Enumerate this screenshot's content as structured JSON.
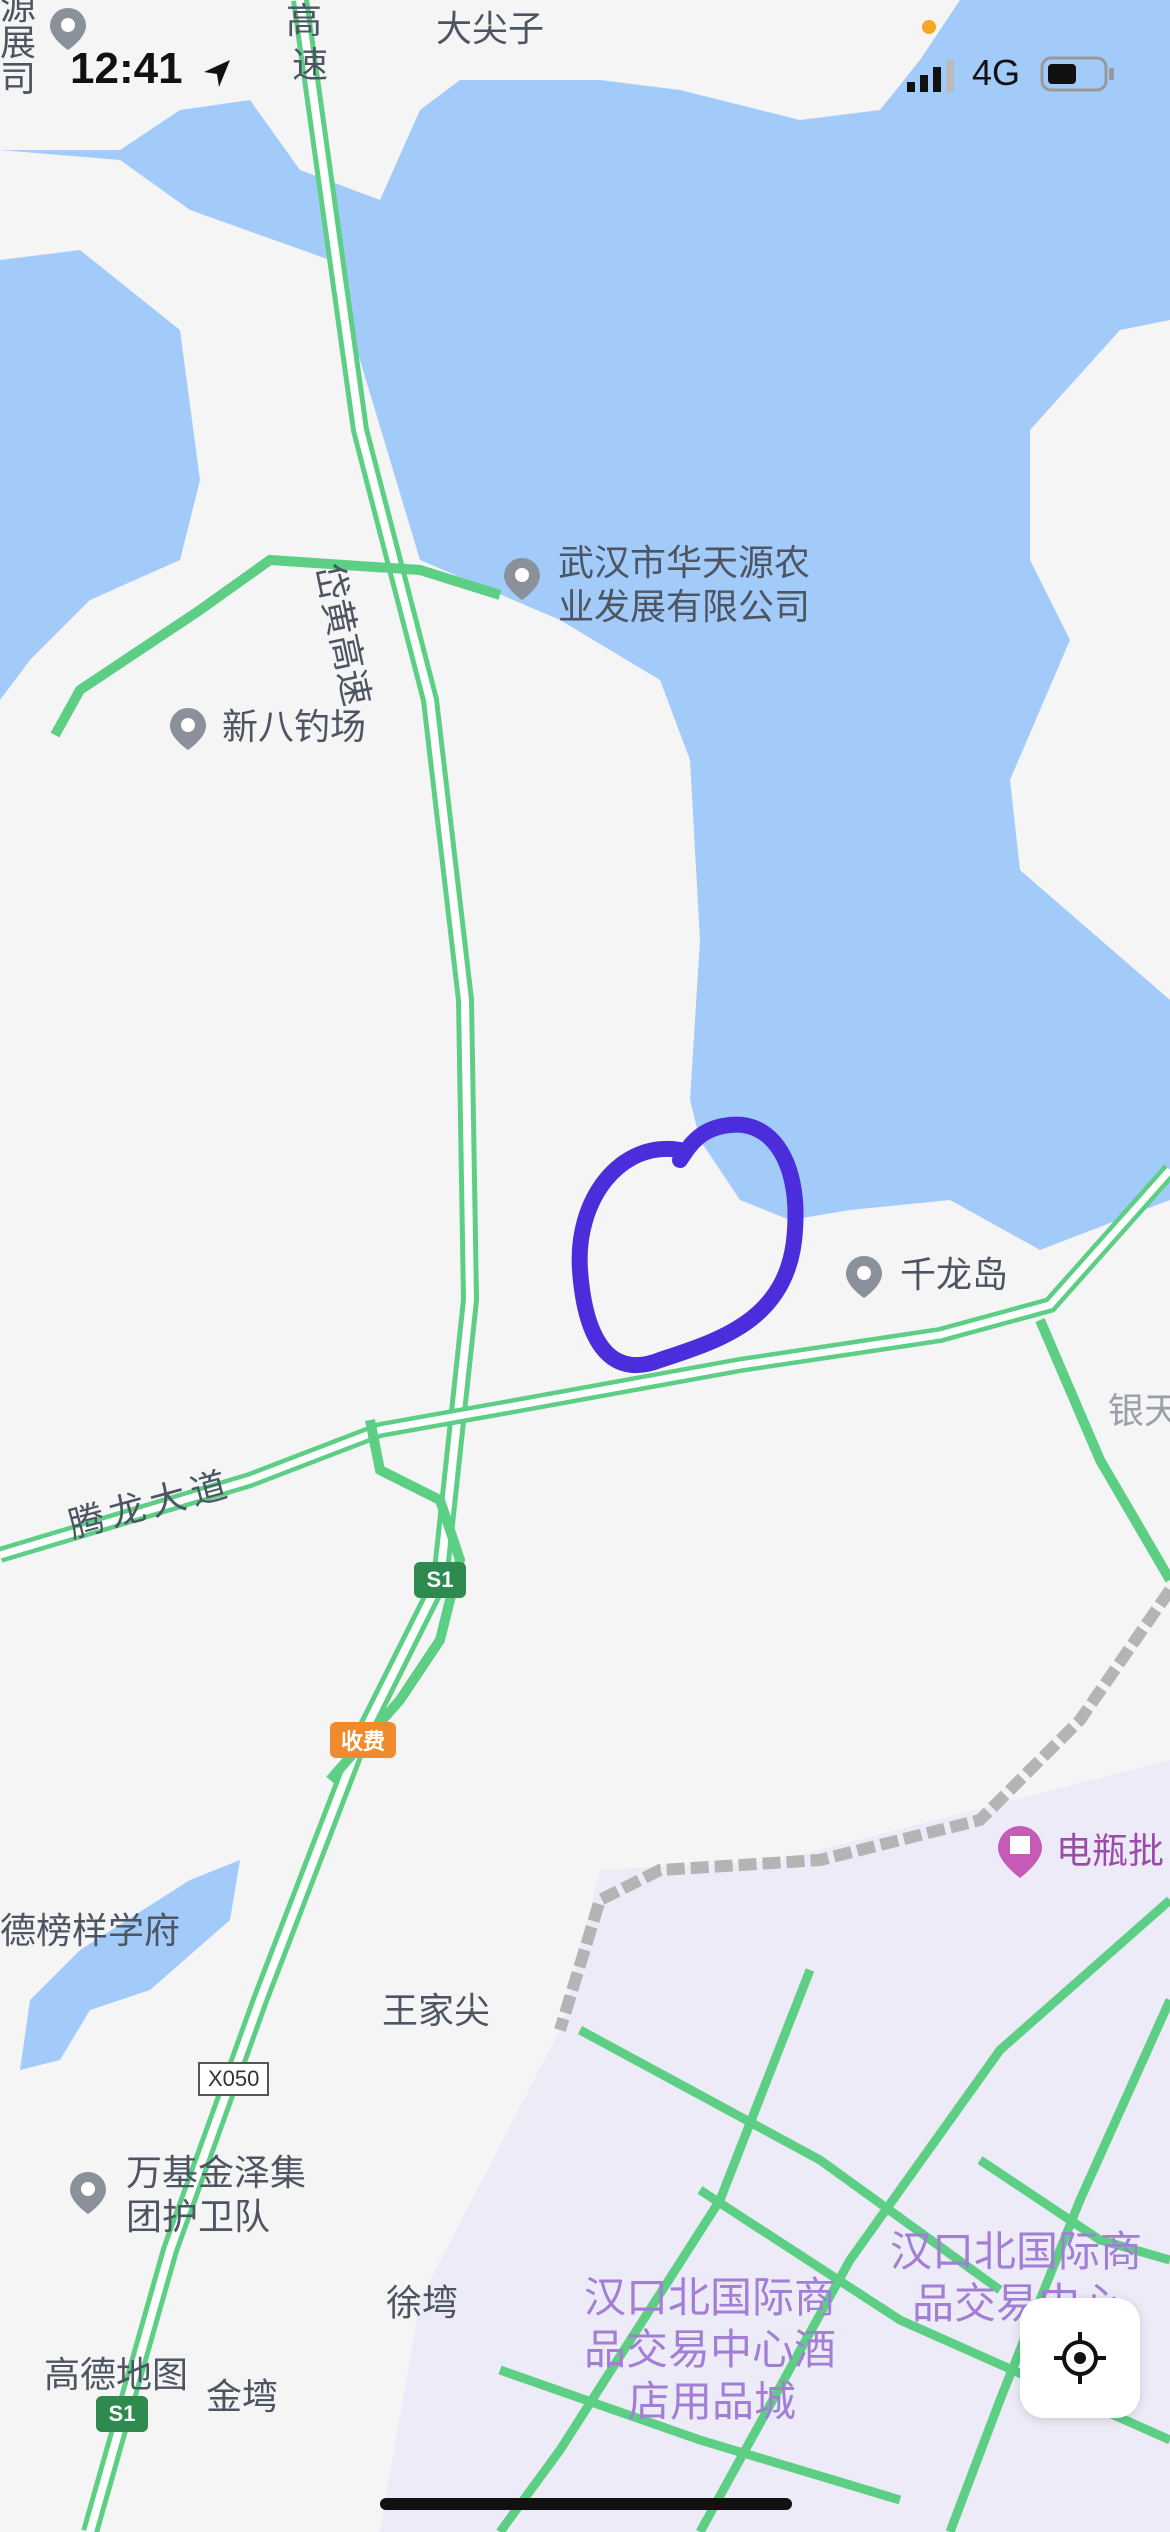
{
  "status_bar": {
    "time": "12:41",
    "network": "4G"
  },
  "map": {
    "colors": {
      "water": "#a3cbfa",
      "land": "#f5f5f6",
      "road_green": "#5ccf85",
      "commercial": "#ecebf7",
      "annotation": "#4b2ddb"
    },
    "labels": {
      "dajianzi": "大尖子",
      "gaosu_top1": "高",
      "gaosu_top2": "速",
      "daihuang": "岱黄高速",
      "wuhan_company_line1": "武汉市华天源农",
      "wuhan_company_line2": "业发展有限公司",
      "xinba": "新八钓场",
      "qianlongdao": "千龙岛",
      "yin": "银天",
      "tenglong": "腾龙大道",
      "school": "德榜样学府",
      "wangjiajian": "王家尖",
      "wanji_line1": "万基金泽集",
      "wanji_line2": "团护卫队",
      "xuwan": "徐塆",
      "jinwan": "金塆",
      "hankou_left_line1": "汉口北国际商",
      "hankou_left_line2": "品交易中心酒",
      "hankou_left_line3": "店用品城",
      "hankou_right_line1": "汉口北国际商",
      "hankou_right_line2": "品交易中心",
      "dianping": "电瓶批",
      "left_edge1": "源",
      "left_edge2": "展",
      "left_edge3": "司",
      "amap": "高德地图"
    },
    "shields": {
      "s1_mid": "S1",
      "s1_bottom": "S1",
      "toll": "收费",
      "x050": "X050"
    },
    "icons": [
      "location-arrow-icon",
      "signal-icon",
      "battery-icon",
      "poi-pin-icon",
      "shop-icon",
      "locate-icon"
    ]
  }
}
